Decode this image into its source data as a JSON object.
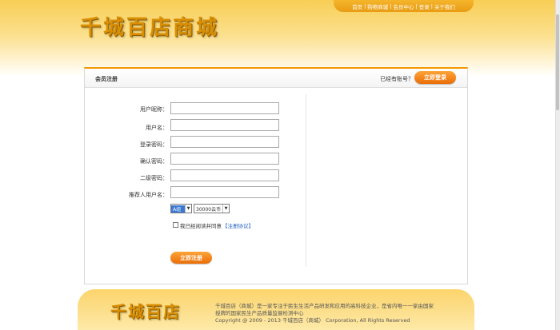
{
  "header": {
    "logo_text": "千城百店商城",
    "nav": [
      "首页",
      "购物商城",
      "会员中心",
      "登录",
      "关于我们"
    ]
  },
  "panel": {
    "title": "会员注册",
    "has_account": "已经有账号？",
    "login_button": "立即登录"
  },
  "form": {
    "fields": [
      {
        "label": "用户昵称：",
        "value": ""
      },
      {
        "label": "用户名：",
        "value": ""
      },
      {
        "label": "登录密码：",
        "value": ""
      },
      {
        "label": "确认密码：",
        "value": ""
      },
      {
        "label": "二级密码：",
        "value": ""
      },
      {
        "label": "推荐人用户名：",
        "value": ""
      }
    ],
    "select_a": "A组",
    "select_b": "30000云币",
    "agree_text": "我已经阅读并同意",
    "agree_link": "【注册协议】",
    "register_button": "立即注册"
  },
  "footer": {
    "logo_text": "千城百店",
    "line1": "千城百店（商城）是一家专注于民生生活产品研发和应用的高科技企业，是省内唯一一家由国家",
    "line2": "授牌的国家民生产品质量监督检测中心",
    "line3": "Copyright @ 2009 - 2013 千城百店（商城） Corporation, All Rights Reserved"
  },
  "colors": {
    "accent": "#f39800",
    "header_gold": "#f8ce55",
    "link_blue": "#1f5fbf"
  }
}
